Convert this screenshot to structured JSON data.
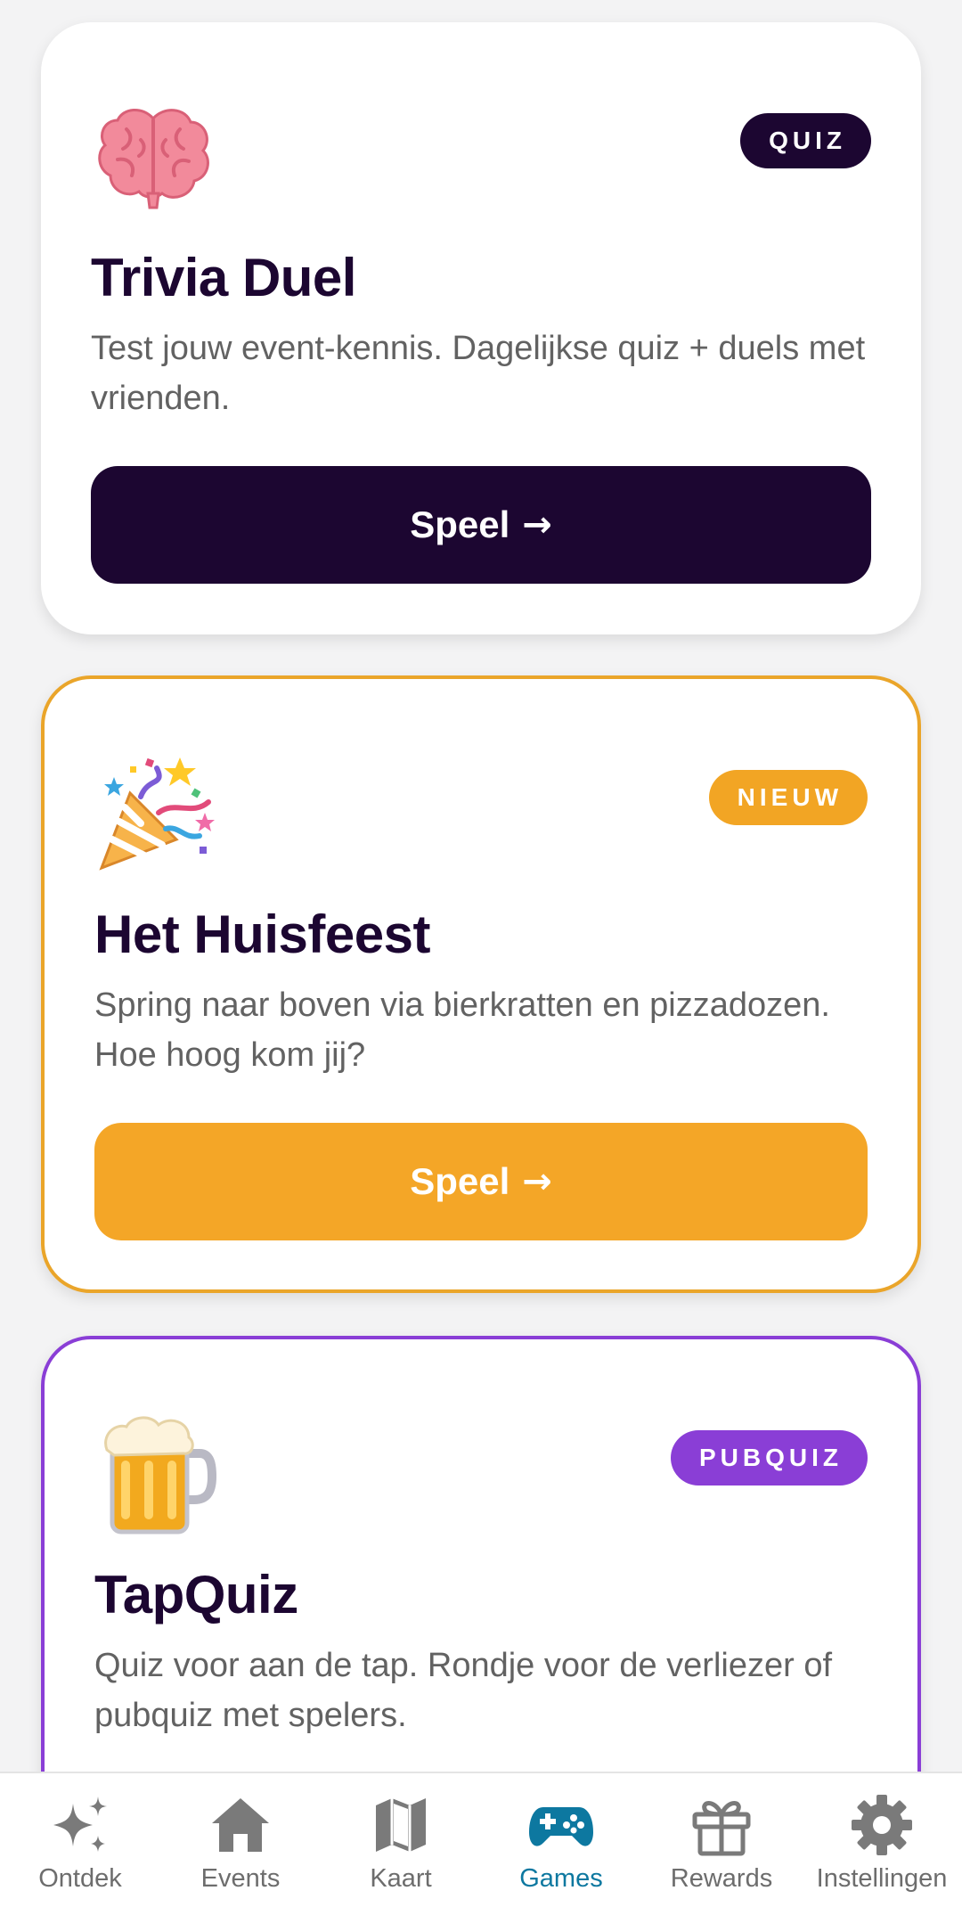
{
  "cards": [
    {
      "emoji_icon": "brain-icon",
      "badge": "QUIZ",
      "title": "Trivia Duel",
      "description": "Test jouw event-kennis. Dagelijkse quiz + duels met vrienden.",
      "play_label": "Speel",
      "arrow": "→",
      "accent_color": "#1c0631"
    },
    {
      "emoji_icon": "party-popper-icon",
      "badge": "NIEUW",
      "title": "Het Huisfeest",
      "description": "Spring naar boven via bierkratten en pizzadozen. Hoe hoog kom jij?",
      "play_label": "Speel",
      "arrow": "→",
      "accent_color": "#f2a524"
    },
    {
      "emoji_icon": "beer-mug-icon",
      "badge": "PUBQUIZ",
      "title": "TapQuiz",
      "description": "Quiz voor aan de tap. Rondje voor de verliezer of pubquiz met spelers.",
      "accent_color": "#8a3ed6"
    }
  ],
  "navbar": {
    "items": [
      {
        "label": "Ontdek",
        "icon": "sparkles-icon"
      },
      {
        "label": "Events",
        "icon": "home-icon"
      },
      {
        "label": "Kaart",
        "icon": "map-icon"
      },
      {
        "label": "Games",
        "icon": "gamepad-icon",
        "active": true
      },
      {
        "label": "Rewards",
        "icon": "gift-icon"
      },
      {
        "label": "Instellingen",
        "icon": "gear-icon"
      }
    ],
    "active_color": "#0d78a0",
    "inactive_color": "#6d6d6d"
  }
}
